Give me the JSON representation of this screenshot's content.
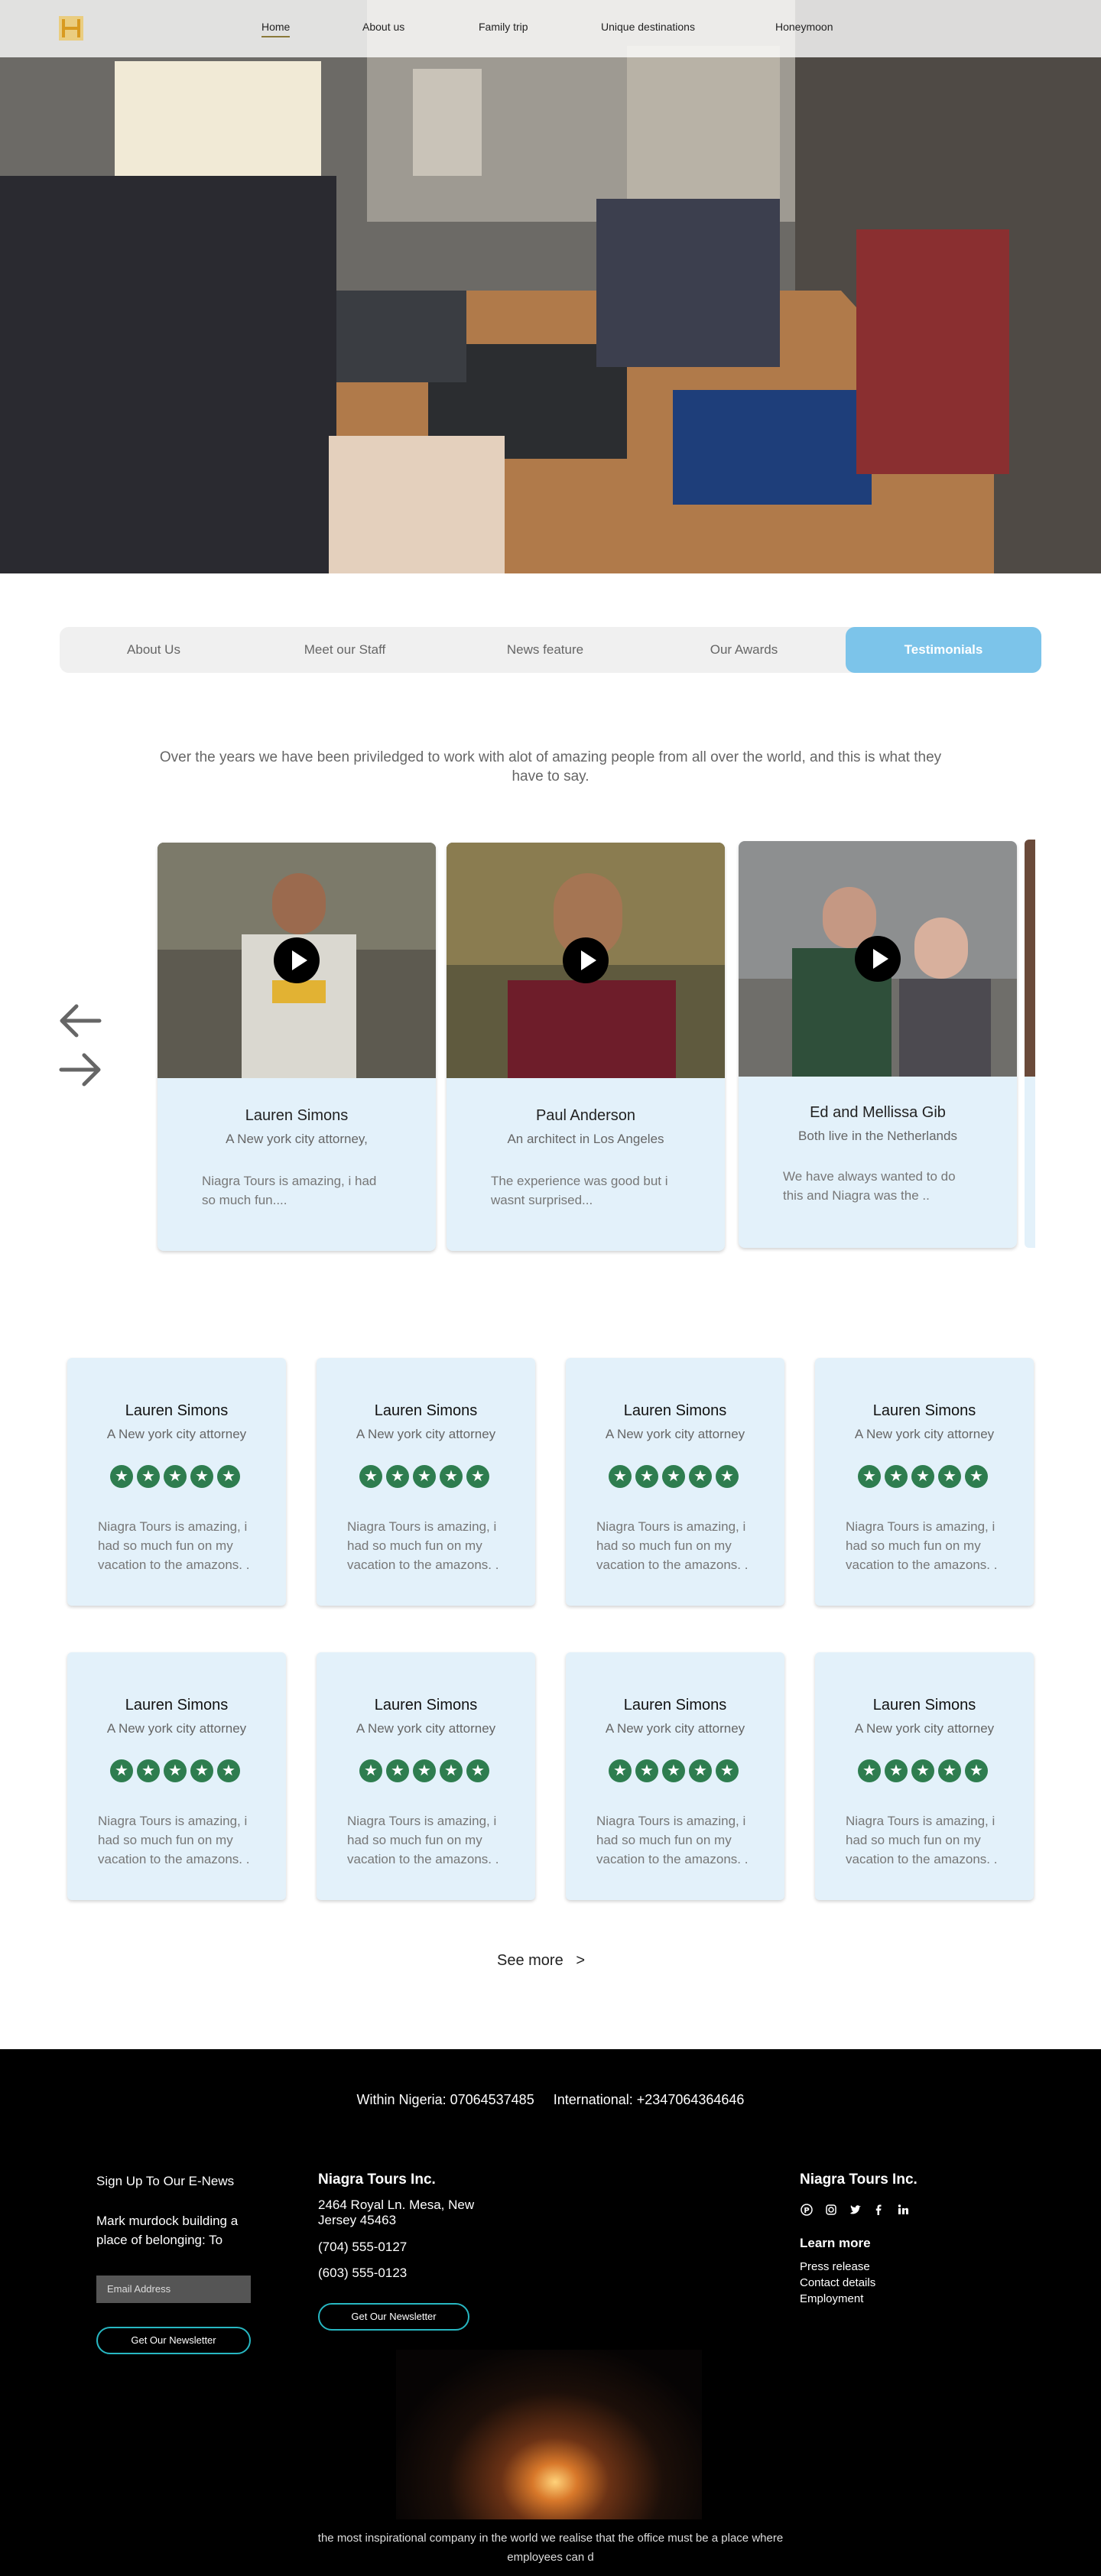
{
  "nav": {
    "logo": "logo-icon",
    "items": [
      {
        "label": "Home"
      },
      {
        "label": "About us"
      },
      {
        "label": "Family trip"
      },
      {
        "label": "Unique destinations"
      },
      {
        "label": "Honeymoon"
      }
    ]
  },
  "tabs": [
    {
      "label": "About Us"
    },
    {
      "label": "Meet our Staff"
    },
    {
      "label": "News feature"
    },
    {
      "label": "Our Awards"
    },
    {
      "label": "Testimonials"
    }
  ],
  "intro": "Over the years we have been priviledged to work with alot of amazing people from all over the world, and this is what they have to say.",
  "carousel": [
    {
      "name": "Lauren Simons",
      "role": "A New york city attorney,",
      "quote": "Niagra Tours is amazing, i had so much fun...."
    },
    {
      "name": "Paul Anderson",
      "role": "An architect in Los Angeles",
      "quote": "The experience was good but i wasnt surprised..."
    },
    {
      "name": "Ed and Mellissa Gib",
      "role": "Both live in the Netherlands",
      "quote": "We have always wanted to do this and Niagra was the .."
    }
  ],
  "reviews": [
    {
      "name": "Lauren Simons",
      "role": "A New york city attorney",
      "rating": 5,
      "quote": "Niagra Tours is amazing, i had so much fun on my vacation to the amazons. ."
    },
    {
      "name": "Lauren Simons",
      "role": "A New york city attorney",
      "rating": 5,
      "quote": "Niagra Tours is amazing, i had so much fun on my vacation to the amazons. ."
    },
    {
      "name": "Lauren Simons",
      "role": "A New york city attorney",
      "rating": 5,
      "quote": "Niagra Tours is amazing, i had so much fun on my vacation to the amazons. ."
    },
    {
      "name": "Lauren Simons",
      "role": "A New york city attorney",
      "rating": 5,
      "quote": "Niagra Tours is amazing, i had so much fun on my vacation to the amazons. ."
    },
    {
      "name": "Lauren Simons",
      "role": "A New york city attorney",
      "rating": 5,
      "quote": "Niagra Tours is amazing, i had so much fun on my vacation to the amazons. ."
    },
    {
      "name": "Lauren Simons",
      "role": "A New york city attorney",
      "rating": 5,
      "quote": "Niagra Tours is amazing, i had so much fun on my vacation to the amazons. ."
    },
    {
      "name": "Lauren Simons",
      "role": "A New york city attorney",
      "rating": 5,
      "quote": "Niagra Tours is amazing, i had so much fun on my vacation to the amazons. ."
    },
    {
      "name": "Lauren Simons",
      "role": "A New york city attorney",
      "rating": 5,
      "quote": "Niagra Tours is amazing, i had so much fun on my vacation to the amazons. ."
    }
  ],
  "see_more": "See more   >",
  "footer": {
    "phones": "Within Nigeria: 07064537485     International: +2347064364646",
    "enews_title": "Sign Up To Our E-News",
    "enews_text": "Mark murdock building a place of belonging: To",
    "email_placeholder": "Email Address",
    "newsletter_button": "Get Our Newsletter",
    "company": "Niagra Tours Inc.",
    "address": "2464 Royal Ln. Mesa, New Jersey 45463",
    "phone1": "(704) 555-0127",
    "phone2": "(603) 555-0123",
    "newsletter_button_2": "Get Our Newsletter",
    "company_right": "Niagra Tours Inc.",
    "social": [
      "pinterest-icon",
      "instagram-icon",
      "twitter-icon",
      "facebook-icon",
      "linkedin-icon"
    ],
    "learn_more": "Learn more",
    "links": [
      "Press release",
      "Contact details",
      "Employment"
    ],
    "tagline": "the most inspirational company in the world we realise that the office must be a place where employees can d"
  },
  "colors": {
    "accent": "#7cc4ea",
    "card_bg": "#e3f1fa",
    "star": "#2e7d4f",
    "button_border": "#27b7c2"
  }
}
